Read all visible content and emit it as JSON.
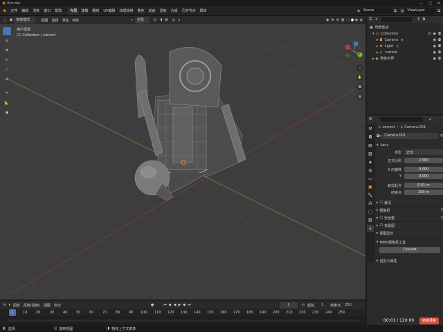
{
  "app": {
    "title": "Blender"
  },
  "menu": [
    "文件",
    "编辑",
    "渲染",
    "窗口",
    "帮助"
  ],
  "workspaces": [
    "布局",
    "建模",
    "雕刻",
    "UV编辑",
    "纹理绘制",
    "着色",
    "动画",
    "渲染",
    "合成",
    "几何节点",
    "脚本"
  ],
  "active_workspace": "布局",
  "scene": {
    "name": "Scene",
    "view_layer": "ViewLayer"
  },
  "viewport_header": {
    "mode": "物体模式",
    "view": "视图",
    "select": "选择",
    "add": "添加",
    "object": "物体",
    "orientation": "全局",
    "options": "选项"
  },
  "viewport_overlay": {
    "line1": "用户透视",
    "line2": "(1) Collection | current"
  },
  "gizmo": {
    "x": "X",
    "y": "Y",
    "z": "Z"
  },
  "outliner": {
    "root": "场景集合",
    "items": [
      {
        "label": "Collection",
        "indent": 1
      },
      {
        "label": "Camera",
        "indent": 2
      },
      {
        "label": "Light",
        "indent": 2
      },
      {
        "label": "current",
        "indent": 2
      },
      {
        "label": "刚体世界",
        "indent": 1
      }
    ]
  },
  "properties": {
    "breadcrumb_a": "current",
    "breadcrumb_b": "Camera.001",
    "data_name": "Camera.001",
    "section_lens": "Lens",
    "type_label": "类型",
    "type_value": "正交",
    "ortho_label": "正交比例",
    "ortho_value": "2.000",
    "shift_x_label": "X 向偏移",
    "shift_x_value": "0.000",
    "shift_y_label": "Y",
    "shift_y_value": "0.000",
    "clip_start_label": "裁剪起点",
    "clip_start_value": "0.01 m",
    "clip_end_label": "结束点",
    "clip_end_value": "100 m",
    "panels": [
      "景深",
      "摄像机",
      "安全框",
      "背景图",
      "视图显示"
    ],
    "mmd_section": "MMD摄像机工具",
    "convert_button": "Convert",
    "custom_props": "自定义属性",
    "time_display": "00:01 / 120:00",
    "record_button": "结束录制"
  },
  "timeline": {
    "playback": "回放",
    "keying": "抠像(插帧)",
    "view": "视图",
    "marker": "标记",
    "current_frame": "1",
    "start_label": "起始",
    "start_value": "1",
    "end_label": "结束点",
    "end_value": "250",
    "ruler": [
      "1",
      "10",
      "20",
      "30",
      "40",
      "50",
      "60",
      "70",
      "80",
      "90",
      "100",
      "110",
      "120",
      "130",
      "140",
      "150",
      "160",
      "170",
      "180",
      "190",
      "200",
      "210",
      "220",
      "230",
      "240",
      "250"
    ]
  },
  "status": {
    "select": "选择",
    "rotate": "旋转视图",
    "menu": "物体上下文菜单"
  },
  "colors": {
    "accent": "#4772b3",
    "record": "#d84b3a",
    "axis_x": "#c9424f",
    "axis_y": "#84b83a"
  }
}
